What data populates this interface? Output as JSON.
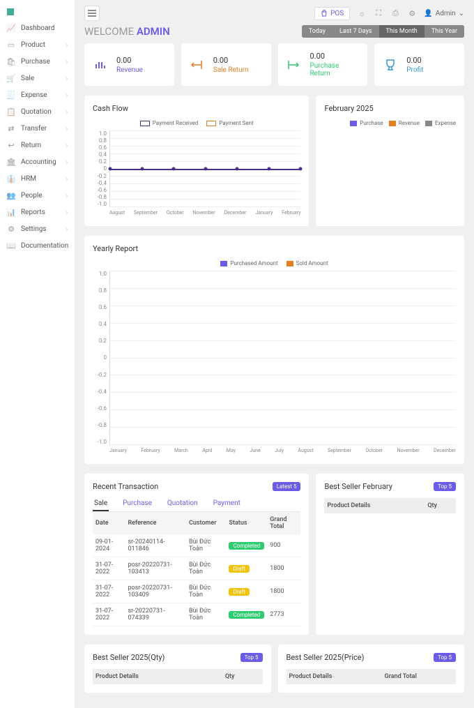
{
  "sidebar": {
    "items": [
      {
        "label": "Dashboard",
        "expandable": false
      },
      {
        "label": "Product",
        "expandable": true
      },
      {
        "label": "Purchase",
        "expandable": true
      },
      {
        "label": "Sale",
        "expandable": true
      },
      {
        "label": "Expense",
        "expandable": true
      },
      {
        "label": "Quotation",
        "expandable": true
      },
      {
        "label": "Transfer",
        "expandable": true
      },
      {
        "label": "Return",
        "expandable": true
      },
      {
        "label": "Accounting",
        "expandable": true
      },
      {
        "label": "HRM",
        "expandable": true
      },
      {
        "label": "People",
        "expandable": true
      },
      {
        "label": "Reports",
        "expandable": true
      },
      {
        "label": "Settings",
        "expandable": true
      },
      {
        "label": "Documentation",
        "expandable": false
      }
    ]
  },
  "topbar": {
    "pos": "POS",
    "admin": "Admin"
  },
  "welcome": {
    "text": "WELCOME ",
    "name": "ADMIN"
  },
  "periodTabs": [
    "Today",
    "Last 7 Days",
    "This Month",
    "This Year"
  ],
  "activePeriod": "This Month",
  "kpis": [
    {
      "value": "0.00",
      "label": "Revenue",
      "color": "#6b5ce7"
    },
    {
      "value": "0.00",
      "label": "Sale Return",
      "color": "#e67e22"
    },
    {
      "value": "0.00",
      "label": "Purchase Return",
      "color": "#2ecc71"
    },
    {
      "value": "0.00",
      "label": "Profit",
      "color": "#3498db"
    }
  ],
  "cashflow": {
    "title": "Cash Flow",
    "legend": [
      "Payment Received",
      "Payment Sent"
    ],
    "yticks": [
      "1.0",
      "0.8",
      "0.6",
      "0.4",
      "0.2",
      "0",
      "-0.2",
      "-0.4",
      "-0.6",
      "-0.8",
      "-1.0"
    ],
    "xticks": [
      "August",
      "September",
      "October",
      "November",
      "December",
      "January",
      "February"
    ]
  },
  "feb": {
    "title": "February 2025",
    "legend": [
      {
        "label": "Purchase",
        "color": "#6b5ce7"
      },
      {
        "label": "Revenue",
        "color": "#e67e22"
      },
      {
        "label": "Expense",
        "color": "#888"
      }
    ]
  },
  "yearly": {
    "title": "Yearly Report",
    "legend": [
      {
        "label": "Purchased Amount",
        "color": "#6b5ce7"
      },
      {
        "label": "Sold Amount",
        "color": "#e67e22"
      }
    ],
    "yticks": [
      "1.0",
      "0.8",
      "0.6",
      "0.4",
      "0.2",
      "0",
      "-0.2",
      "-0.4",
      "-0.6",
      "-0.8",
      "-1.0"
    ],
    "xticks": [
      "January",
      "February",
      "March",
      "April",
      "May",
      "June",
      "July",
      "August",
      "September",
      "October",
      "November",
      "December"
    ]
  },
  "recent": {
    "title": "Recent Transaction",
    "badge": "Latest 5",
    "subtabs": [
      "Sale",
      "Purchase",
      "Quotation",
      "Payment"
    ],
    "activeSubtab": "Sale",
    "columns": [
      "Date",
      "Reference",
      "Customer",
      "Status",
      "Grand Total"
    ],
    "rows": [
      {
        "date": "09-01-2024",
        "ref": "sr-20240114-011846",
        "cust": "Bùi Đức Toàn",
        "status": "Completed",
        "statusClass": "st-completed",
        "total": "900"
      },
      {
        "date": "31-07-2022",
        "ref": "posr-20220731-103413",
        "cust": "Bùi Đức Toàn",
        "status": "Draft",
        "statusClass": "st-draft",
        "total": "1800"
      },
      {
        "date": "31-07-2022",
        "ref": "posr-20220731-103409",
        "cust": "Bùi Đức Toàn",
        "status": "Draft",
        "statusClass": "st-draft",
        "total": "1800"
      },
      {
        "date": "31-07-2022",
        "ref": "sr-20220731-074339",
        "cust": "Bùi Đức Toàn",
        "status": "Completed",
        "statusClass": "st-completed",
        "total": "2773"
      }
    ]
  },
  "bsFeb": {
    "title": "Best Seller February",
    "badge": "Top 5",
    "cols": [
      "Product Details",
      "Qty"
    ]
  },
  "bsQty": {
    "title": "Best Seller 2025(Qty)",
    "badge": "Top 5",
    "cols": [
      "Product Details",
      "Qty"
    ]
  },
  "bsPrice": {
    "title": "Best Seller 2025(Price)",
    "badge": "Top 5",
    "cols": [
      "Product Details",
      "Grand Total"
    ]
  },
  "chart_data": [
    {
      "type": "line",
      "title": "Cash Flow",
      "series": [
        {
          "name": "Payment Received",
          "values": [
            0,
            0,
            0,
            0,
            0,
            0,
            0
          ]
        },
        {
          "name": "Payment Sent",
          "values": [
            0,
            0,
            0,
            0,
            0,
            0,
            0
          ]
        }
      ],
      "categories": [
        "August",
        "September",
        "October",
        "November",
        "December",
        "January",
        "February"
      ],
      "ylim": [
        -1,
        1
      ]
    },
    {
      "type": "bar",
      "title": "Yearly Report",
      "series": [
        {
          "name": "Purchased Amount",
          "values": [
            0,
            0,
            0,
            0,
            0,
            0,
            0,
            0,
            0,
            0,
            0,
            0
          ]
        },
        {
          "name": "Sold Amount",
          "values": [
            0,
            0,
            0,
            0,
            0,
            0,
            0,
            0,
            0,
            0,
            0,
            0
          ]
        }
      ],
      "categories": [
        "January",
        "February",
        "March",
        "April",
        "May",
        "June",
        "July",
        "August",
        "September",
        "October",
        "November",
        "December"
      ],
      "ylim": [
        -1,
        1
      ]
    }
  ]
}
